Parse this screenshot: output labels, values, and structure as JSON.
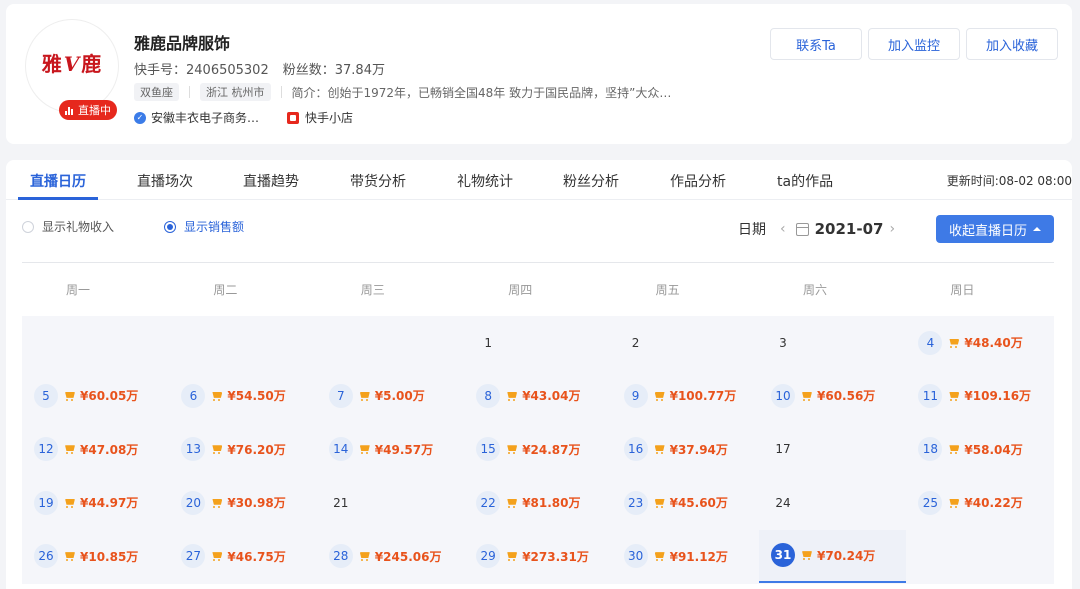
{
  "profile": {
    "logo_text": "雅鹿",
    "live_badge": "直播中",
    "name": "雅鹿品牌服饰",
    "kuaishou_id_label": "快手号：",
    "kuaishou_id": "2406505302",
    "fans_label": "粉丝数：",
    "fans": "37.84万",
    "tags": [
      "双鱼座",
      "浙江 杭州市"
    ],
    "intro": "简介：创始于1972年，已畅销全国48年 致力于国民品牌，坚持”大众…",
    "company": "安徽丰衣电子商务…",
    "shop": "快手小店"
  },
  "actions": [
    "联系Ta",
    "加入监控",
    "加入收藏"
  ],
  "tabs": [
    "直播日历",
    "直播场次",
    "直播趋势",
    "带货分析",
    "礼物统计",
    "粉丝分析",
    "作品分析",
    "ta的作品"
  ],
  "update_time": "更新时间:08-02 08:00",
  "radios": [
    {
      "label": "显示礼物收入",
      "checked": false
    },
    {
      "label": "显示销售额",
      "checked": true
    }
  ],
  "date_nav": {
    "label": "日期",
    "value": "2021-07"
  },
  "collapse_button": "收起直播日历",
  "weekdays": [
    "周一",
    "周二",
    "周三",
    "周四",
    "周五",
    "周六",
    "周日"
  ],
  "calendar": {
    "first_weekday_index": 3,
    "selected_day": 31,
    "days": [
      {
        "day": 1,
        "sales": ""
      },
      {
        "day": 2,
        "sales": ""
      },
      {
        "day": 3,
        "sales": ""
      },
      {
        "day": 4,
        "sales": "¥48.40万"
      },
      {
        "day": 5,
        "sales": "¥60.05万"
      },
      {
        "day": 6,
        "sales": "¥54.50万"
      },
      {
        "day": 7,
        "sales": "¥5.00万"
      },
      {
        "day": 8,
        "sales": "¥43.04万"
      },
      {
        "day": 9,
        "sales": "¥100.77万"
      },
      {
        "day": 10,
        "sales": "¥60.56万"
      },
      {
        "day": 11,
        "sales": "¥109.16万"
      },
      {
        "day": 12,
        "sales": "¥47.08万"
      },
      {
        "day": 13,
        "sales": "¥76.20万"
      },
      {
        "day": 14,
        "sales": "¥49.57万"
      },
      {
        "day": 15,
        "sales": "¥24.87万"
      },
      {
        "day": 16,
        "sales": "¥37.94万"
      },
      {
        "day": 17,
        "sales": ""
      },
      {
        "day": 18,
        "sales": "¥58.04万"
      },
      {
        "day": 19,
        "sales": "¥44.97万"
      },
      {
        "day": 20,
        "sales": "¥30.98万"
      },
      {
        "day": 21,
        "sales": ""
      },
      {
        "day": 22,
        "sales": "¥81.80万"
      },
      {
        "day": 23,
        "sales": "¥45.60万"
      },
      {
        "day": 24,
        "sales": ""
      },
      {
        "day": 25,
        "sales": "¥40.22万"
      },
      {
        "day": 26,
        "sales": "¥10.85万"
      },
      {
        "day": 27,
        "sales": "¥46.75万"
      },
      {
        "day": 28,
        "sales": "¥245.06万"
      },
      {
        "day": 29,
        "sales": "¥273.31万"
      },
      {
        "day": 30,
        "sales": "¥91.12万"
      },
      {
        "day": 31,
        "sales": "¥70.24万"
      }
    ]
  }
}
